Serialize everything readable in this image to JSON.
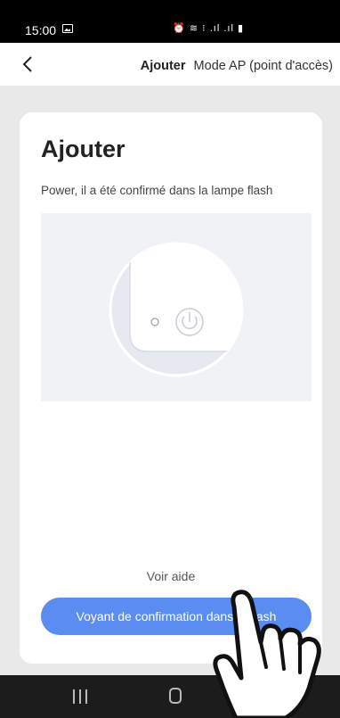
{
  "status_bar": {
    "time": "15:00",
    "right_icons": "⏰ ≋ ⁝ .ıl .ıl ▮"
  },
  "app_bar": {
    "title": "Ajouter",
    "subtitle": "Mode AP (point d'accès)"
  },
  "card": {
    "title": "Ajouter",
    "description": "Power, il a été confirmé dans la lampe flash",
    "help_link": "Voir aide",
    "confirm_button": "Voyant de confirmation dans le flash"
  },
  "icons": {
    "back": "chevron-left-icon",
    "image_notification": "image-icon",
    "power": "power-icon",
    "hand": "pointing-hand-icon"
  },
  "colors": {
    "accent": "#5b8cf2",
    "status_bar": "#000000",
    "nav_bar": "#1c1c1c",
    "page_background": "#e9e9e9"
  }
}
